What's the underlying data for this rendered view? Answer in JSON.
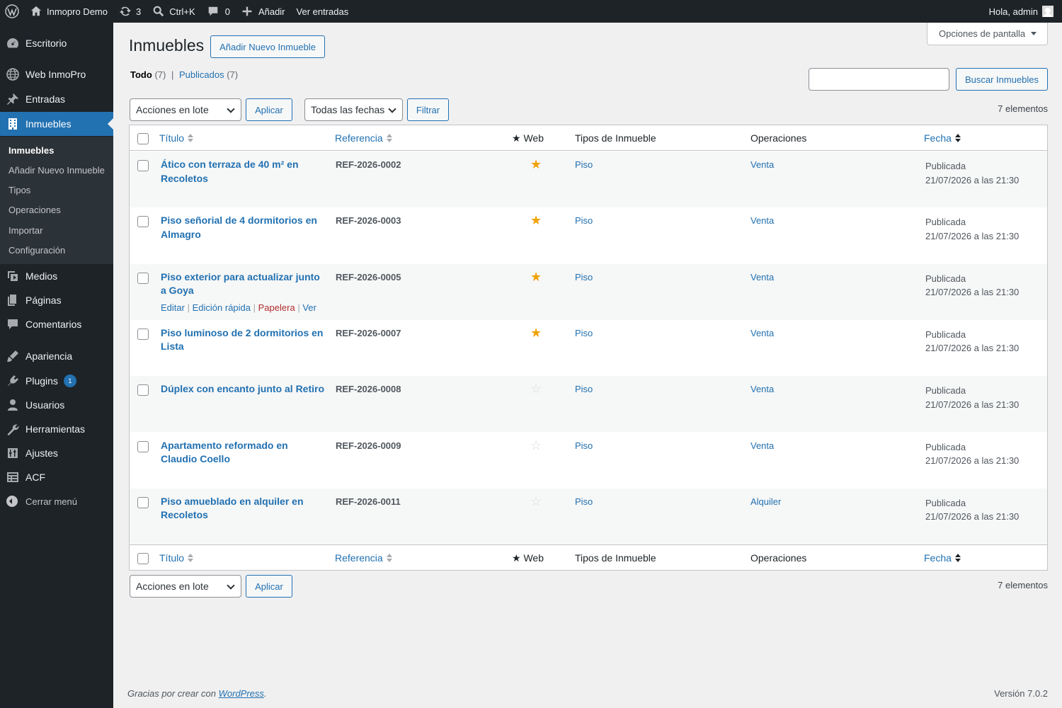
{
  "adminbar": {
    "site_name": "Inmopro Demo",
    "updates_count": "3",
    "search_shortcut": "Ctrl+K",
    "comments_count": "0",
    "add_new": "Añadir",
    "view_posts": "Ver entradas",
    "greeting": "Hola, admin"
  },
  "sidebar": {
    "items": [
      {
        "label": "Escritorio",
        "icon": "dashboard-icon"
      },
      {
        "label": "Web InmoPro",
        "icon": "globe-icon"
      },
      {
        "label": "Entradas",
        "icon": "pin-icon"
      },
      {
        "label": "Inmuebles",
        "icon": "building-icon"
      },
      {
        "label": "Medios",
        "icon": "media-icon"
      },
      {
        "label": "Páginas",
        "icon": "pages-icon"
      },
      {
        "label": "Comentarios",
        "icon": "comment-icon"
      },
      {
        "label": "Apariencia",
        "icon": "brush-icon"
      },
      {
        "label": "Plugins",
        "icon": "plugin-icon",
        "badge": "1"
      },
      {
        "label": "Usuarios",
        "icon": "user-icon"
      },
      {
        "label": "Herramientas",
        "icon": "wrench-icon"
      },
      {
        "label": "Ajustes",
        "icon": "settings-icon"
      },
      {
        "label": "ACF",
        "icon": "acf-icon"
      }
    ],
    "submenu": [
      "Inmuebles",
      "Añadir Nuevo Inmueble",
      "Tipos",
      "Operaciones",
      "Importar",
      "Configuración"
    ],
    "collapse": "Cerrar menú"
  },
  "page": {
    "title": "Inmuebles",
    "add_new": "Añadir Nuevo Inmueble",
    "screen_options": "Opciones de pantalla",
    "filter_all": "Todo",
    "filter_all_count": "(7)",
    "filter_sep": "|",
    "filter_published": "Publicados",
    "filter_published_count": "(7)",
    "search_value": "",
    "search_button": "Buscar Inmuebles",
    "bulk_actions": "Acciones en lote",
    "apply": "Aplicar",
    "all_dates": "Todas las fechas",
    "filter": "Filtrar",
    "items_count": "7 elementos"
  },
  "table": {
    "columns": {
      "title": "Título",
      "reference": "Referencia",
      "web": "★ Web",
      "types": "Tipos de Inmueble",
      "operations": "Operaciones",
      "date": "Fecha"
    },
    "rows": [
      {
        "title": "Ático con terraza de 40 m² en Recoletos",
        "ref": "REF-2026-0002",
        "star": "★",
        "type": "Piso",
        "operation": "Venta",
        "status": "Publicada",
        "date": "21/07/2026 a las 21:30"
      },
      {
        "title": "Piso señorial de 4 dormitorios en Almagro",
        "ref": "REF-2026-0003",
        "star": "★",
        "type": "Piso",
        "operation": "Venta",
        "status": "Publicada",
        "date": "21/07/2026 a las 21:30"
      },
      {
        "title": "Piso exterior para actualizar junto a Goya",
        "ref": "REF-2026-0005",
        "star": "★",
        "type": "Piso",
        "operation": "Venta",
        "status": "Publicada",
        "date": "21/07/2026 a las 21:30"
      },
      {
        "title": "Piso luminoso de 2 dormitorios en Lista",
        "ref": "REF-2026-0007",
        "star": "★",
        "type": "Piso",
        "operation": "Venta",
        "status": "Publicada",
        "date": "21/07/2026 a las 21:30"
      },
      {
        "title": "Dúplex con encanto junto al Retiro",
        "ref": "REF-2026-0008",
        "star": "☆",
        "type": "Piso",
        "operation": "Venta",
        "status": "Publicada",
        "date": "21/07/2026 a las 21:30"
      },
      {
        "title": "Apartamento reformado en Claudio Coello",
        "ref": "REF-2026-0009",
        "star": "☆",
        "type": "Piso",
        "operation": "Venta",
        "status": "Publicada",
        "date": "21/07/2026 a las 21:30"
      },
      {
        "title": "Piso amueblado en alquiler en Recoletos",
        "ref": "REF-2026-0011",
        "star": "☆",
        "type": "Piso",
        "operation": "Alquiler",
        "status": "Publicada",
        "date": "21/07/2026 a las 21:30"
      }
    ],
    "row_actions": {
      "edit": "Editar",
      "quick_edit": "Edición rápida",
      "trash": "Papelera",
      "view": "Ver",
      "sep": "|"
    }
  },
  "footer": {
    "thanks_prefix": "Gracias por crear con",
    "wordpress": "WordPress",
    "period": ".",
    "version": "Versión 7.0.2"
  },
  "colors": {
    "accent": "#2271b1",
    "star_on": "#f0a30a",
    "sidebar": "#1d2327"
  }
}
